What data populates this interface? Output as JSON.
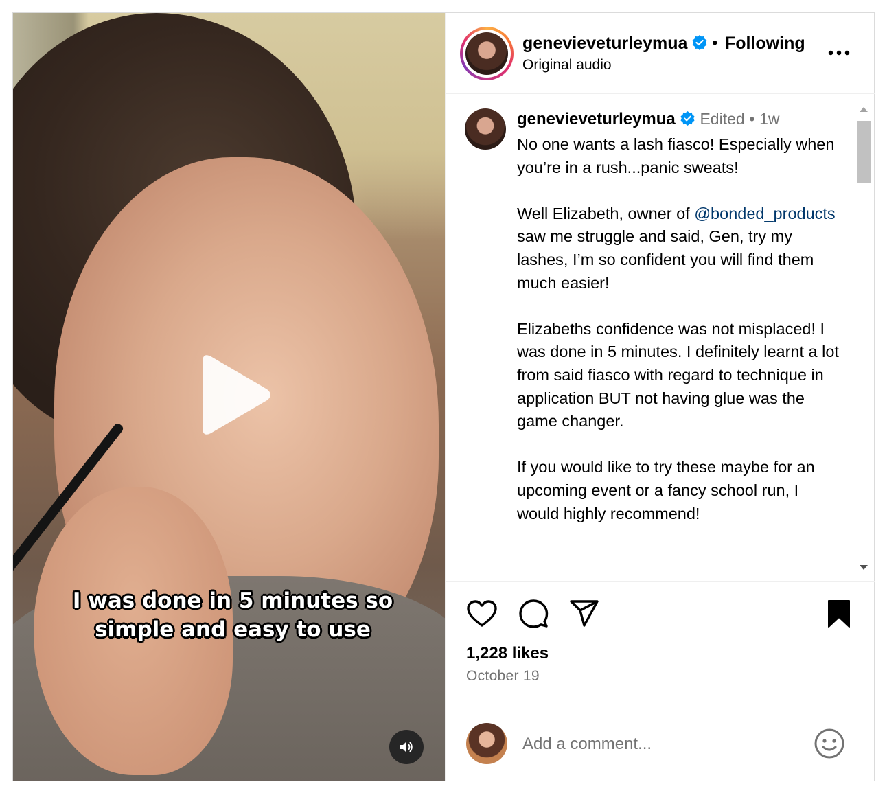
{
  "video": {
    "caption_line1": "I was done in 5 minutes so",
    "caption_line2": "simple and easy to use"
  },
  "header": {
    "username": "genevieveturleymua",
    "separator": "•",
    "follow_status": "Following",
    "audio": "Original audio"
  },
  "post_caption": {
    "username": "genevieveturleymua",
    "edited": "Edited",
    "separator": "•",
    "time_ago": "1w",
    "para1": "No one wants a lash fiasco! Especially when you’re in a rush...panic sweats!",
    "para2_before": "Well Elizabeth, owner of ",
    "para2_mention": "@bonded_products",
    "para2_after": " saw me struggle and said, Gen, try my lashes, I’m so confident you will find them much easier!",
    "para3": "Elizabeths confidence was not misplaced! I was done in 5 minutes. I definitely learnt a lot from said fiasco with regard to technique in application BUT not having glue was the game changer.",
    "para4": "If you would like to try these maybe for an upcoming event or a fancy school run, I would highly recommend!"
  },
  "actions": {
    "likes": "1,228 likes",
    "date": "October 19"
  },
  "comment_box": {
    "placeholder": "Add a comment..."
  },
  "icons": [
    "play-icon",
    "sound-icon",
    "verified-icon",
    "more-icon",
    "heart-icon",
    "comment-icon",
    "share-icon",
    "bookmark-icon",
    "emoji-icon"
  ],
  "colors": {
    "verified": "#0095f6",
    "mention": "#00376b",
    "secondary_text": "#737373",
    "border": "#dbdbdb"
  }
}
